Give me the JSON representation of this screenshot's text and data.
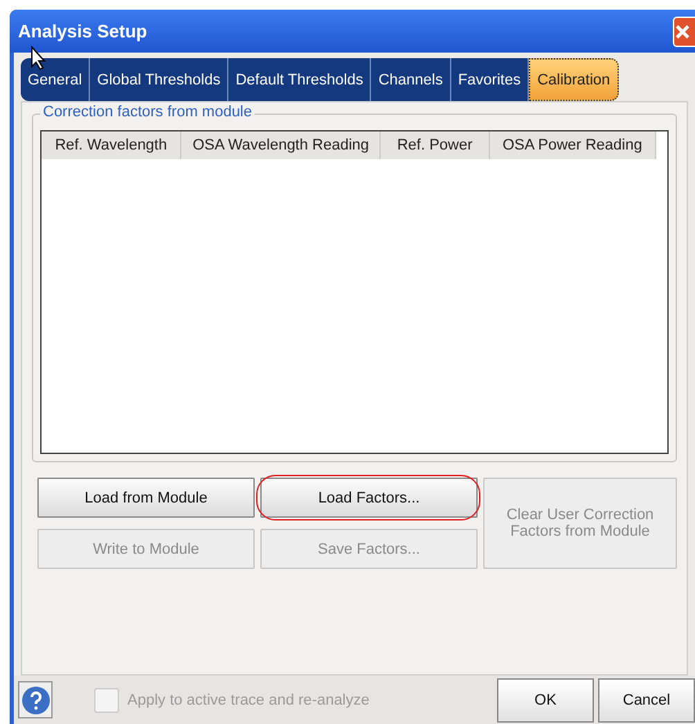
{
  "window": {
    "title": "Analysis Setup"
  },
  "tabs": [
    {
      "label": "General",
      "selected": false
    },
    {
      "label": "Global Thresholds",
      "selected": false
    },
    {
      "label": "Default Thresholds",
      "selected": false
    },
    {
      "label": "Channels",
      "selected": false
    },
    {
      "label": "Favorites",
      "selected": false
    },
    {
      "label": "Calibration",
      "selected": true
    }
  ],
  "group": {
    "title": "Correction factors from module"
  },
  "table": {
    "columns": [
      "Ref. Wavelength",
      "OSA Wavelength Reading",
      "Ref. Power",
      "OSA Power Reading"
    ]
  },
  "buttons": [
    {
      "label": "Load from Module",
      "disabled": false,
      "highlighted": false
    },
    {
      "label": "Load Factors...",
      "disabled": false,
      "highlighted": true
    },
    {
      "label": "Write to Module",
      "disabled": true,
      "highlighted": false
    },
    {
      "label": "Save Factors...",
      "disabled": true,
      "highlighted": false
    }
  ],
  "clear_button": {
    "label": "Clear User Correction Factors from Module",
    "disabled": true
  },
  "apply_checkbox": {
    "label": "Apply to active trace and re-analyze",
    "checked": false,
    "disabled": true
  },
  "footer_buttons": [
    "OK",
    "Cancel"
  ]
}
